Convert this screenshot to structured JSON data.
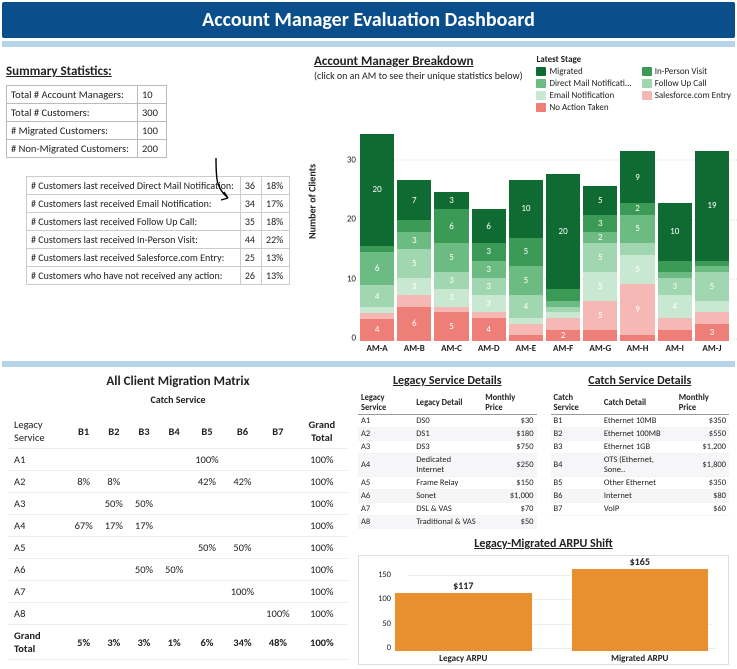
{
  "title": "Account Manager Evaluation Dashboard",
  "summary": {
    "heading": "Summary Statistics:",
    "rows": [
      {
        "label": "Total # Account Managers:",
        "value": "10"
      },
      {
        "label": "Total # Customers:",
        "value": "300"
      },
      {
        "label": "# Migrated Customers:",
        "value": "100"
      },
      {
        "label": "# Non-Migrated Customers:",
        "value": "200"
      }
    ],
    "breakdown_rows": [
      {
        "label": "# Customers last received Direct Mail Notification:",
        "n": "36",
        "pct": "18%"
      },
      {
        "label": "# Customers last received Email Notification:",
        "n": "34",
        "pct": "17%"
      },
      {
        "label": "# Customers last received Follow Up Call:",
        "n": "35",
        "pct": "18%"
      },
      {
        "label": "# Customers last received In-Person Visit:",
        "n": "44",
        "pct": "22%"
      },
      {
        "label": "# Customers last received Salesforce.com Entry:",
        "n": "25",
        "pct": "13%"
      },
      {
        "label": "# Customers who have not received any action:",
        "n": "26",
        "pct": "13%"
      }
    ]
  },
  "am_chart": {
    "title": "Account Manager Breakdown",
    "subtitle": "(click on an AM to see their unique statistics below)",
    "legend_title": "Latest Stage",
    "ylabel": "Number of Clients",
    "legend": [
      {
        "name": "Migrated",
        "color": "#0f6b32"
      },
      {
        "name": "In-Person Visit",
        "color": "#3a9a56"
      },
      {
        "name": "Direct Mail Notificati...",
        "color": "#6cbb83"
      },
      {
        "name": "Follow Up Call",
        "color": "#a0d6b0"
      },
      {
        "name": "Email Notification",
        "color": "#c9e8d2"
      },
      {
        "name": "Salesforce.com Entry",
        "color": "#f5b8b4"
      },
      {
        "name": "No Action Taken",
        "color": "#ee7f78"
      }
    ],
    "ymax": 36,
    "yticks": [
      "0",
      "10",
      "20",
      "30"
    ],
    "categories": [
      "AM-A",
      "AM-B",
      "AM-C",
      "AM-D",
      "AM-E",
      "AM-F",
      "AM-G",
      "AM-H",
      "AM-I",
      "AM-J"
    ],
    "stacks": [
      {
        "cat": "AM-A",
        "segs": [
          {
            "label": "4",
            "v": 4,
            "c": "#ee7f78"
          },
          {
            "label": "",
            "v": 1,
            "c": "#f5b8b4"
          },
          {
            "label": "",
            "v": 1,
            "c": "#c9e8d2"
          },
          {
            "label": "4",
            "v": 4,
            "c": "#a0d6b0"
          },
          {
            "label": "6",
            "v": 6,
            "c": "#6cbb83"
          },
          {
            "label": "",
            "v": 1,
            "c": "#3a9a56"
          },
          {
            "label": "20",
            "v": 20,
            "c": "#0f6b32"
          }
        ]
      },
      {
        "cat": "AM-B",
        "segs": [
          {
            "label": "6",
            "v": 6,
            "c": "#ee7f78"
          },
          {
            "label": "",
            "v": 2,
            "c": "#f5b8b4"
          },
          {
            "label": "3",
            "v": 3,
            "c": "#c9e8d2"
          },
          {
            "label": "5",
            "v": 5,
            "c": "#a0d6b0"
          },
          {
            "label": "3",
            "v": 3,
            "c": "#6cbb83"
          },
          {
            "label": "",
            "v": 2,
            "c": "#3a9a56"
          },
          {
            "label": "7",
            "v": 7,
            "c": "#0f6b32"
          }
        ]
      },
      {
        "cat": "AM-C",
        "segs": [
          {
            "label": "5",
            "v": 5,
            "c": "#ee7f78"
          },
          {
            "label": "",
            "v": 1,
            "c": "#f5b8b4"
          },
          {
            "label": "3",
            "v": 3,
            "c": "#c9e8d2"
          },
          {
            "label": "3",
            "v": 3,
            "c": "#a0d6b0"
          },
          {
            "label": "5",
            "v": 5,
            "c": "#6cbb83"
          },
          {
            "label": "6",
            "v": 6,
            "c": "#3a9a56"
          },
          {
            "label": "3",
            "v": 3,
            "c": "#0f6b32"
          }
        ]
      },
      {
        "cat": "AM-D",
        "segs": [
          {
            "label": "4",
            "v": 4,
            "c": "#ee7f78"
          },
          {
            "label": "",
            "v": 1,
            "c": "#f5b8b4"
          },
          {
            "label": "3",
            "v": 3,
            "c": "#c9e8d2"
          },
          {
            "label": "3",
            "v": 3,
            "c": "#a0d6b0"
          },
          {
            "label": "3",
            "v": 3,
            "c": "#6cbb83"
          },
          {
            "label": "3",
            "v": 3,
            "c": "#3a9a56"
          },
          {
            "label": "6",
            "v": 6,
            "c": "#0f6b32"
          }
        ]
      },
      {
        "cat": "AM-E",
        "segs": [
          {
            "label": "",
            "v": 1,
            "c": "#ee7f78"
          },
          {
            "label": "",
            "v": 2,
            "c": "#f5b8b4"
          },
          {
            "label": "",
            "v": 1,
            "c": "#c9e8d2"
          },
          {
            "label": "4",
            "v": 4,
            "c": "#a0d6b0"
          },
          {
            "label": "5",
            "v": 5,
            "c": "#6cbb83"
          },
          {
            "label": "5",
            "v": 5,
            "c": "#3a9a56"
          },
          {
            "label": "10",
            "v": 10,
            "c": "#0f6b32"
          }
        ]
      },
      {
        "cat": "AM-F",
        "segs": [
          {
            "label": "2",
            "v": 2,
            "c": "#ee7f78"
          },
          {
            "label": "",
            "v": 2,
            "c": "#f5b8b4"
          },
          {
            "label": "",
            "v": 1,
            "c": "#c9e8d2"
          },
          {
            "label": "",
            "v": 1,
            "c": "#a0d6b0"
          },
          {
            "label": "",
            "v": 1,
            "c": "#6cbb83"
          },
          {
            "label": "",
            "v": 2,
            "c": "#3a9a56"
          },
          {
            "label": "20",
            "v": 20,
            "c": "#0f6b32"
          }
        ]
      },
      {
        "cat": "AM-G",
        "segs": [
          {
            "label": "",
            "v": 2,
            "c": "#ee7f78"
          },
          {
            "label": "5",
            "v": 5,
            "c": "#f5b8b4"
          },
          {
            "label": "5",
            "v": 5,
            "c": "#c9e8d2"
          },
          {
            "label": "5",
            "v": 5,
            "c": "#a0d6b0"
          },
          {
            "label": "2",
            "v": 2,
            "c": "#6cbb83"
          },
          {
            "label": "3",
            "v": 3,
            "c": "#3a9a56"
          },
          {
            "label": "5",
            "v": 5,
            "c": "#0f6b32"
          }
        ]
      },
      {
        "cat": "AM-H",
        "segs": [
          {
            "label": "",
            "v": 1,
            "c": "#ee7f78"
          },
          {
            "label": "9",
            "v": 9,
            "c": "#f5b8b4"
          },
          {
            "label": "5",
            "v": 5,
            "c": "#c9e8d2"
          },
          {
            "label": "",
            "v": 2,
            "c": "#a0d6b0"
          },
          {
            "label": "5",
            "v": 5,
            "c": "#6cbb83"
          },
          {
            "label": "2",
            "v": 2,
            "c": "#3a9a56"
          },
          {
            "label": "9",
            "v": 9,
            "c": "#0f6b32"
          }
        ]
      },
      {
        "cat": "AM-I",
        "segs": [
          {
            "label": "",
            "v": 2,
            "c": "#ee7f78"
          },
          {
            "label": "",
            "v": 2,
            "c": "#f5b8b4"
          },
          {
            "label": "4",
            "v": 4,
            "c": "#c9e8d2"
          },
          {
            "label": "3",
            "v": 3,
            "c": "#a0d6b0"
          },
          {
            "label": "",
            "v": 1,
            "c": "#6cbb83"
          },
          {
            "label": "",
            "v": 2,
            "c": "#3a9a56"
          },
          {
            "label": "10",
            "v": 10,
            "c": "#0f6b32"
          }
        ]
      },
      {
        "cat": "AM-J",
        "segs": [
          {
            "label": "3",
            "v": 3,
            "c": "#ee7f78"
          },
          {
            "label": "",
            "v": 2,
            "c": "#f5b8b4"
          },
          {
            "label": "",
            "v": 2,
            "c": "#c9e8d2"
          },
          {
            "label": "5",
            "v": 5,
            "c": "#a0d6b0"
          },
          {
            "label": "",
            "v": 1,
            "c": "#6cbb83"
          },
          {
            "label": "",
            "v": 1,
            "c": "#3a9a56"
          },
          {
            "label": "19",
            "v": 19,
            "c": "#0f6b32"
          }
        ]
      }
    ]
  },
  "matrix": {
    "title": "All Client Migration Matrix",
    "subtitle": "Catch Service",
    "row_header": "Legacy Service",
    "col_headers": [
      "B1",
      "B2",
      "B3",
      "B4",
      "B5",
      "B6",
      "B7"
    ],
    "gt_header": "Grand Total",
    "rows": [
      {
        "label": "A1",
        "cells": [
          "",
          "",
          "",
          "",
          "100%",
          "",
          ""
        ],
        "gt": "100%"
      },
      {
        "label": "A2",
        "cells": [
          "8%",
          "8%",
          "",
          "",
          "42%",
          "42%",
          ""
        ],
        "gt": "100%"
      },
      {
        "label": "A3",
        "cells": [
          "",
          "50%",
          "50%",
          "",
          "",
          "",
          ""
        ],
        "gt": "100%"
      },
      {
        "label": "A4",
        "cells": [
          "67%",
          "17%",
          "17%",
          "",
          "",
          "",
          ""
        ],
        "gt": "100%"
      },
      {
        "label": "A5",
        "cells": [
          "",
          "",
          "",
          "",
          "50%",
          "50%",
          ""
        ],
        "gt": "100%"
      },
      {
        "label": "A6",
        "cells": [
          "",
          "",
          "50%",
          "50%",
          "",
          "",
          ""
        ],
        "gt": "100%"
      },
      {
        "label": "A7",
        "cells": [
          "",
          "",
          "",
          "",
          "",
          "100%",
          ""
        ],
        "gt": "100%"
      },
      {
        "label": "A8",
        "cells": [
          "",
          "",
          "",
          "",
          "",
          "",
          "100%"
        ],
        "gt": "100%"
      }
    ],
    "grand_total": {
      "label": "Grand Total",
      "cells": [
        "5%",
        "3%",
        "3%",
        "1%",
        "6%",
        "34%",
        "48%"
      ],
      "gt": "100%"
    }
  },
  "legacy_details": {
    "title": "Legacy Service Details",
    "cols": [
      "Legacy Service",
      "Legacy Detail",
      "Monthly  Price"
    ],
    "rows": [
      [
        "A1",
        "DS0",
        "$30"
      ],
      [
        "A2",
        "DS1",
        "$180"
      ],
      [
        "A3",
        "DS3",
        "$750"
      ],
      [
        "A4",
        "Dedicated Internet",
        "$250"
      ],
      [
        "A5",
        "Frame Relay",
        "$150"
      ],
      [
        "A6",
        "Sonet",
        "$1,000"
      ],
      [
        "A7",
        "DSL & VAS",
        "$70"
      ],
      [
        "A8",
        "Traditional & VAS",
        "$50"
      ]
    ]
  },
  "catch_details": {
    "title": "Catch Service Details",
    "cols": [
      "Catch Service",
      "Catch Detail",
      "Monthly Price"
    ],
    "rows": [
      [
        "B1",
        "Ethernet 10MB",
        "$350"
      ],
      [
        "B2",
        "Ethernet 100MB",
        "$550"
      ],
      [
        "B3",
        "Ethernet 1GB",
        "$1,200"
      ],
      [
        "B4",
        "OTS (Ethernet, Sone..",
        "$1,800"
      ],
      [
        "B5",
        "Other Ethernet",
        "$350"
      ],
      [
        "B6",
        "Internet",
        "$80"
      ],
      [
        "B7",
        "VoIP",
        "$60"
      ]
    ]
  },
  "arpu": {
    "title": "Legacy-Migrated ARPU Shift",
    "ymax": 180,
    "yticks": [
      "0",
      "50",
      "100",
      "150"
    ],
    "bars": [
      {
        "label": "Legacy ARPU",
        "value": 117,
        "display": "$117"
      },
      {
        "label": "Migrated ARPU",
        "value": 165,
        "display": "$165"
      }
    ]
  },
  "chart_data": {
    "stacked_bar": {
      "type": "bar",
      "title": "Account Manager Breakdown",
      "ylabel": "Number of Clients",
      "ylim": [
        0,
        36
      ],
      "categories": [
        "AM-A",
        "AM-B",
        "AM-C",
        "AM-D",
        "AM-E",
        "AM-F",
        "AM-G",
        "AM-H",
        "AM-I",
        "AM-J"
      ],
      "series": [
        {
          "name": "Migrated",
          "color": "#0f6b32",
          "values": [
            20,
            7,
            3,
            6,
            10,
            20,
            5,
            9,
            10,
            19
          ]
        },
        {
          "name": "In-Person Visit",
          "color": "#3a9a56",
          "values": [
            1,
            2,
            6,
            3,
            5,
            2,
            3,
            2,
            2,
            1
          ]
        },
        {
          "name": "Direct Mail Notification",
          "color": "#6cbb83",
          "values": [
            6,
            3,
            5,
            3,
            5,
            1,
            2,
            5,
            1,
            1
          ]
        },
        {
          "name": "Follow Up Call",
          "color": "#a0d6b0",
          "values": [
            4,
            5,
            3,
            3,
            4,
            1,
            5,
            2,
            3,
            5
          ]
        },
        {
          "name": "Email Notification",
          "color": "#c9e8d2",
          "values": [
            1,
            3,
            3,
            3,
            1,
            1,
            5,
            5,
            4,
            2
          ]
        },
        {
          "name": "Salesforce.com Entry",
          "color": "#f5b8b4",
          "values": [
            1,
            2,
            1,
            1,
            2,
            2,
            5,
            9,
            2,
            2
          ]
        },
        {
          "name": "No Action Taken",
          "color": "#ee7f78",
          "values": [
            4,
            6,
            5,
            4,
            1,
            2,
            2,
            1,
            2,
            3
          ]
        }
      ]
    },
    "arpu_bar": {
      "type": "bar",
      "title": "Legacy-Migrated ARPU Shift",
      "categories": [
        "Legacy ARPU",
        "Migrated ARPU"
      ],
      "values": [
        117,
        165
      ],
      "ylim": [
        0,
        180
      ]
    }
  }
}
